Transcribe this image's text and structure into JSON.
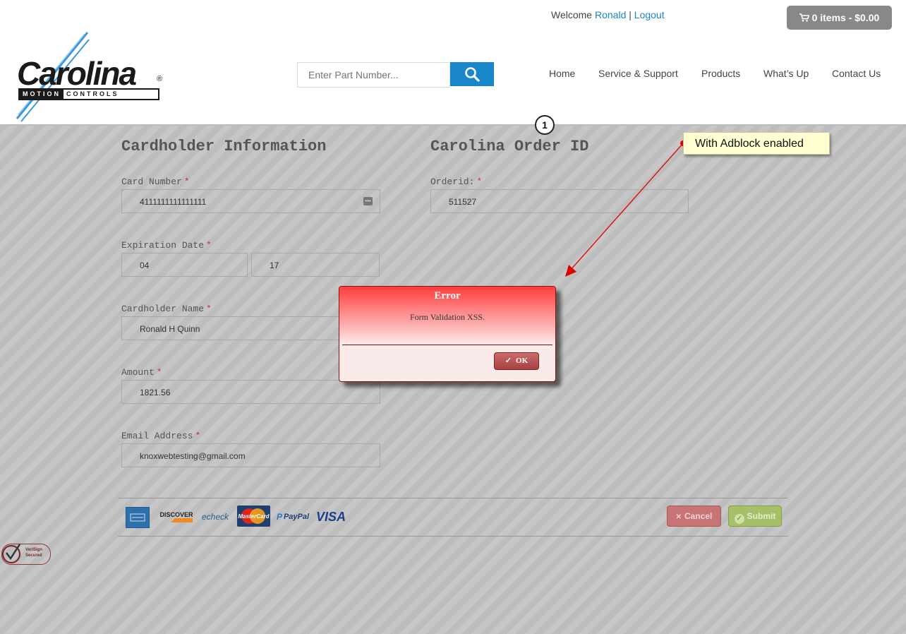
{
  "header": {
    "welcome_prefix": "Welcome",
    "user_name": "Ronald",
    "separator": "|",
    "logout_label": "Logout",
    "cart_label": "0 items - $0.00",
    "search_placeholder": "Enter Part Number...",
    "logo_brand": "Carolina",
    "logo_reg_mark": "®",
    "logo_sub_left": "MOTION",
    "logo_sub_right": "CONTROLS",
    "nav": [
      "Home",
      "Service & Support",
      "Products",
      "What’s Up",
      "Contact Us"
    ]
  },
  "form": {
    "cardholder_title": "Cardholder Information",
    "order_title": "Carolina Order ID",
    "required_mark": "*",
    "card_number_label": "Card Number",
    "card_number_value": "4111111111111111",
    "expiration_label": "Expiration Date",
    "exp_month": "04",
    "exp_year": "17",
    "name_label": "Cardholder Name",
    "name_value": "Ronald H Quinn",
    "amount_label": "Amount",
    "amount_value": "1821.56",
    "email_label": "Email Address",
    "email_value": "knoxwebtesting@gmail.com",
    "orderid_label": "Orderid:",
    "orderid_value": "511527",
    "card_field_icon": "•••",
    "cancel_label": "Cancel",
    "submit_label": "Submit"
  },
  "payment_logos": [
    "DISCOVER",
    "echeck",
    "MasterCard",
    "PayPal",
    "VISA"
  ],
  "verisign": {
    "line1": "VeriSign",
    "line2": "Secured"
  },
  "dialog": {
    "title": "Error",
    "message": "Form Validation XSS.",
    "ok_label": "OK"
  },
  "annotation": {
    "step_number": "1",
    "callout_text": "With Adblock enabled"
  },
  "colors": {
    "accent_blue": "#1886c8",
    "dialog_red": "#ff3d3d",
    "callout_yellow": "#ffffd2",
    "arrow_red": "#e00000"
  }
}
